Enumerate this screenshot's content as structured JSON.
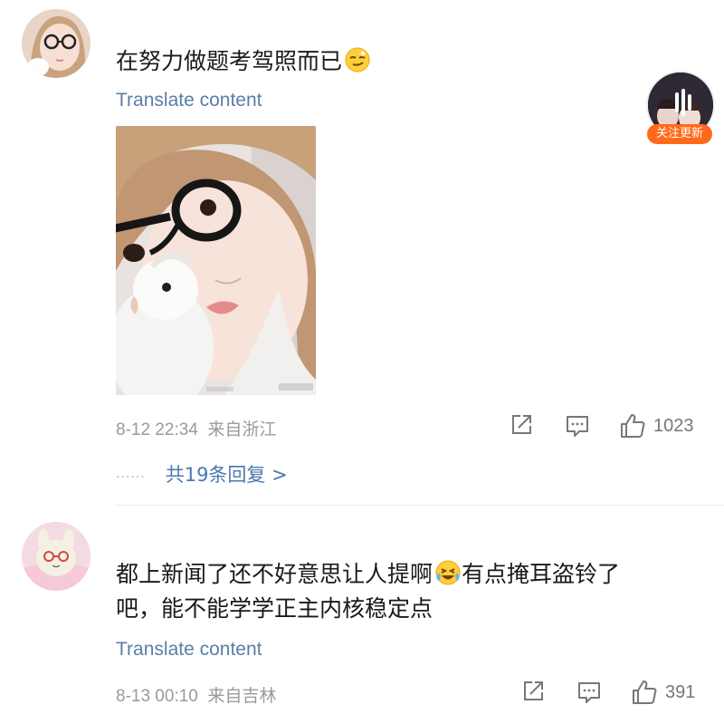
{
  "comments": [
    {
      "text": "在努力做题考驾照而已",
      "emoji": "smirk-emoji",
      "translate_label": "Translate content",
      "timestamp": "8-12 22:34",
      "location": "来自浙江",
      "like_count": "1023",
      "replies_label": "共19条回复 >",
      "replies_dots": "......"
    },
    {
      "text_line1": "都上新闻了还不好意思让人提啊",
      "emoji": "laughing-crying-emoji",
      "text_line1_after": "有点掩耳盗铃了",
      "text_line2": "吧，能不能学学正主内核稳定点",
      "translate_label": "Translate content",
      "timestamp": "8-13 00:10",
      "location": "来自吉林",
      "like_count": "391"
    }
  ],
  "follow_widget": {
    "badge_label": "关注更新"
  },
  "colors": {
    "link": "#5a7fa6",
    "replies": "#4a78b0",
    "meta": "#9a9a9a",
    "badge": "#ff6a1a"
  }
}
